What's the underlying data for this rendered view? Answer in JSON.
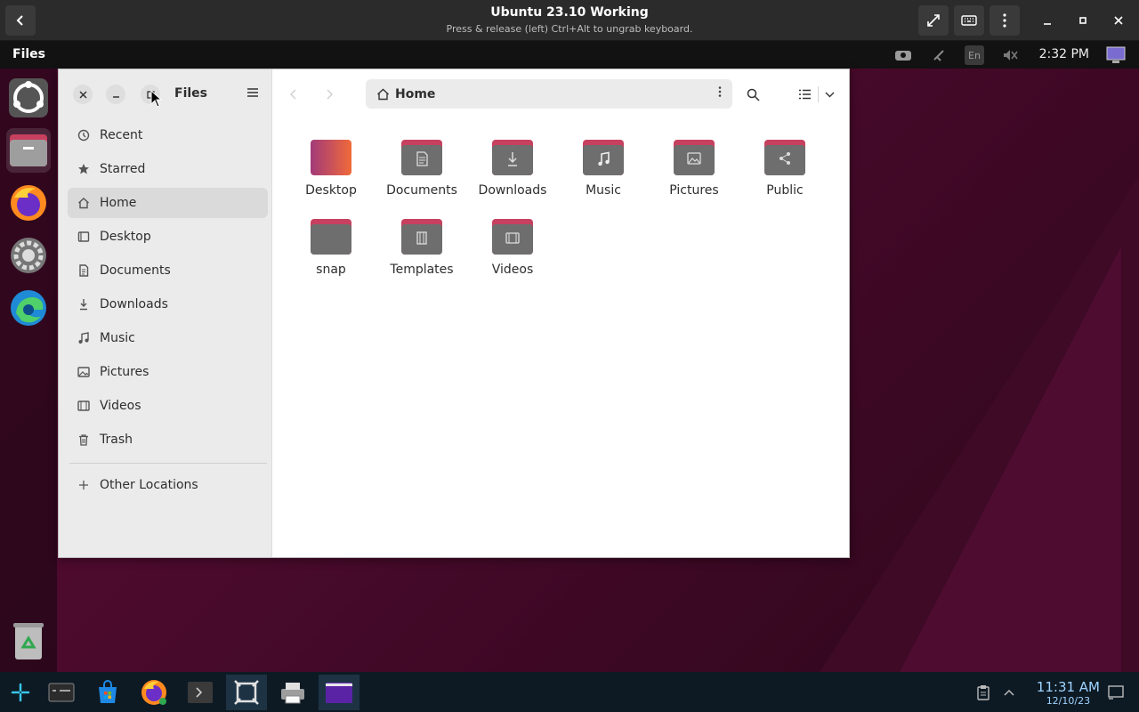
{
  "viewer": {
    "title": "Ubuntu 23.10 Working",
    "subtitle": "Press & release (left) Ctrl+Alt to ungrab keyboard.",
    "icons": [
      "back-arrow-icon",
      "fullscreen-icon",
      "keyboard-icon",
      "more-vert-icon",
      "minimize-icon",
      "maximize-icon",
      "close-icon"
    ]
  },
  "topbar": {
    "app_name": "Files",
    "lang": "En",
    "clock": "2:32 PM",
    "tray_icons": [
      "accessibility-icon",
      "network-icon",
      "language-icon",
      "volume-muted-icon",
      "display-icon"
    ]
  },
  "dock": {
    "items": [
      "ubuntu-icon",
      "files-icon",
      "firefox-icon",
      "settings-icon",
      "edge-icon",
      "recycle-bin-icon"
    ]
  },
  "files_window": {
    "sidebar_title": "Files",
    "sidebar": [
      {
        "label": "Recent",
        "icon": "clock-icon"
      },
      {
        "label": "Starred",
        "icon": "star-icon"
      },
      {
        "label": "Home",
        "icon": "home-icon",
        "selected": true
      },
      {
        "label": "Desktop",
        "icon": "desktop-icon"
      },
      {
        "label": "Documents",
        "icon": "document-icon"
      },
      {
        "label": "Downloads",
        "icon": "download-icon"
      },
      {
        "label": "Music",
        "icon": "music-icon"
      },
      {
        "label": "Pictures",
        "icon": "picture-icon"
      },
      {
        "label": "Videos",
        "icon": "video-icon"
      },
      {
        "label": "Trash",
        "icon": "trash-icon"
      }
    ],
    "other_locations": "Other Locations",
    "path_label": "Home",
    "folders": [
      {
        "name": "Desktop",
        "icon": "desktop-folder-icon"
      },
      {
        "name": "Documents",
        "icon": "documents-folder-icon"
      },
      {
        "name": "Downloads",
        "icon": "downloads-folder-icon"
      },
      {
        "name": "Music",
        "icon": "music-folder-icon"
      },
      {
        "name": "Pictures",
        "icon": "pictures-folder-icon"
      },
      {
        "name": "Public",
        "icon": "public-folder-icon"
      },
      {
        "name": "snap",
        "icon": "folder-icon"
      },
      {
        "name": "Templates",
        "icon": "templates-folder-icon"
      },
      {
        "name": "Videos",
        "icon": "videos-folder-icon"
      }
    ]
  },
  "taskbar": {
    "time": "11:31 AM",
    "date": "12/10/23",
    "items": [
      "start-icon",
      "task-view-icon",
      "store-icon",
      "firefox-icon",
      "terminal-icon",
      "app-icon",
      "printer-icon",
      "files-icon"
    ]
  },
  "colors": {
    "folder_tab": "#c7405f",
    "folder_body": "#6e6e6e",
    "desktop_bg": "#4a0a2c",
    "accent": "#e95420"
  }
}
